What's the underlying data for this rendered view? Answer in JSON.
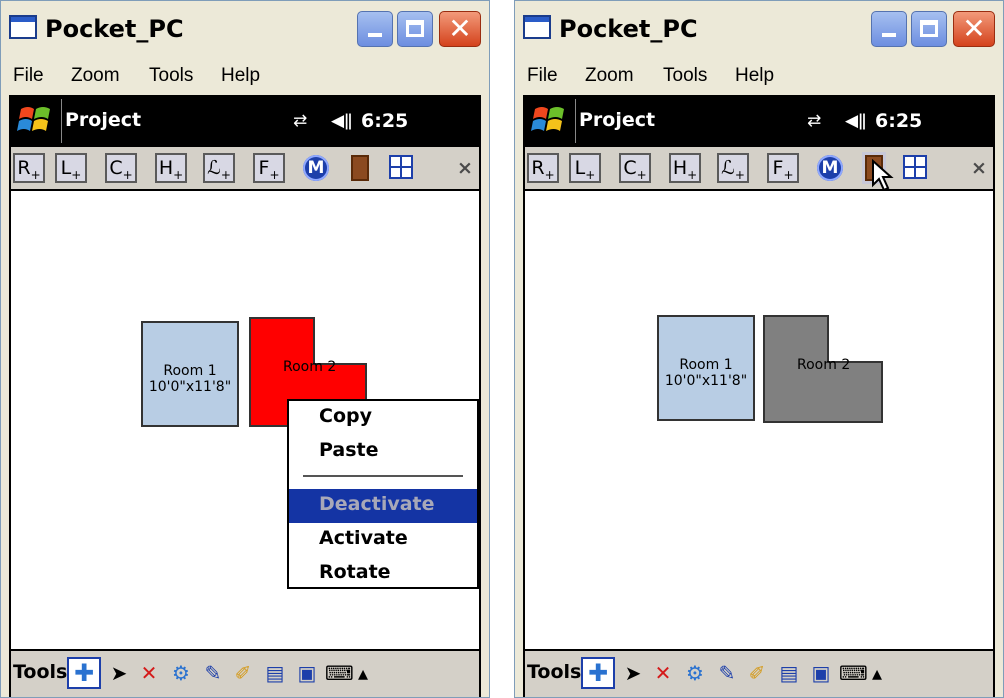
{
  "left": {
    "title": "Pocket_PC",
    "menu": [
      "File",
      "Zoom",
      "Tools",
      "Help"
    ],
    "nav_title": "Project",
    "time": "6:25",
    "toolbar_letters": [
      "R",
      "L",
      "C",
      "H",
      "ℒ",
      "F"
    ],
    "m_label": "M",
    "x_label": "×",
    "room1_name": "Room 1",
    "room1_dims": "10'0\"x11'8\"",
    "room2_name": "Room 2",
    "room2_color": "#ff0000",
    "context_menu": [
      "Copy",
      "Paste",
      "Deactivate",
      "Activate",
      "Rotate"
    ],
    "bottom_label": "Tools"
  },
  "right": {
    "title": "Pocket_PC",
    "menu": [
      "File",
      "Zoom",
      "Tools",
      "Help"
    ],
    "nav_title": "Project",
    "time": "6:25",
    "toolbar_letters": [
      "R",
      "L",
      "C",
      "H",
      "ℒ",
      "F"
    ],
    "m_label": "M",
    "x_label": "×",
    "room1_name": "Room 1",
    "room1_dims": "10'0\"x11'8\"",
    "room2_name": "Room 2",
    "room2_color": "#808080",
    "bottom_label": "Tools"
  }
}
